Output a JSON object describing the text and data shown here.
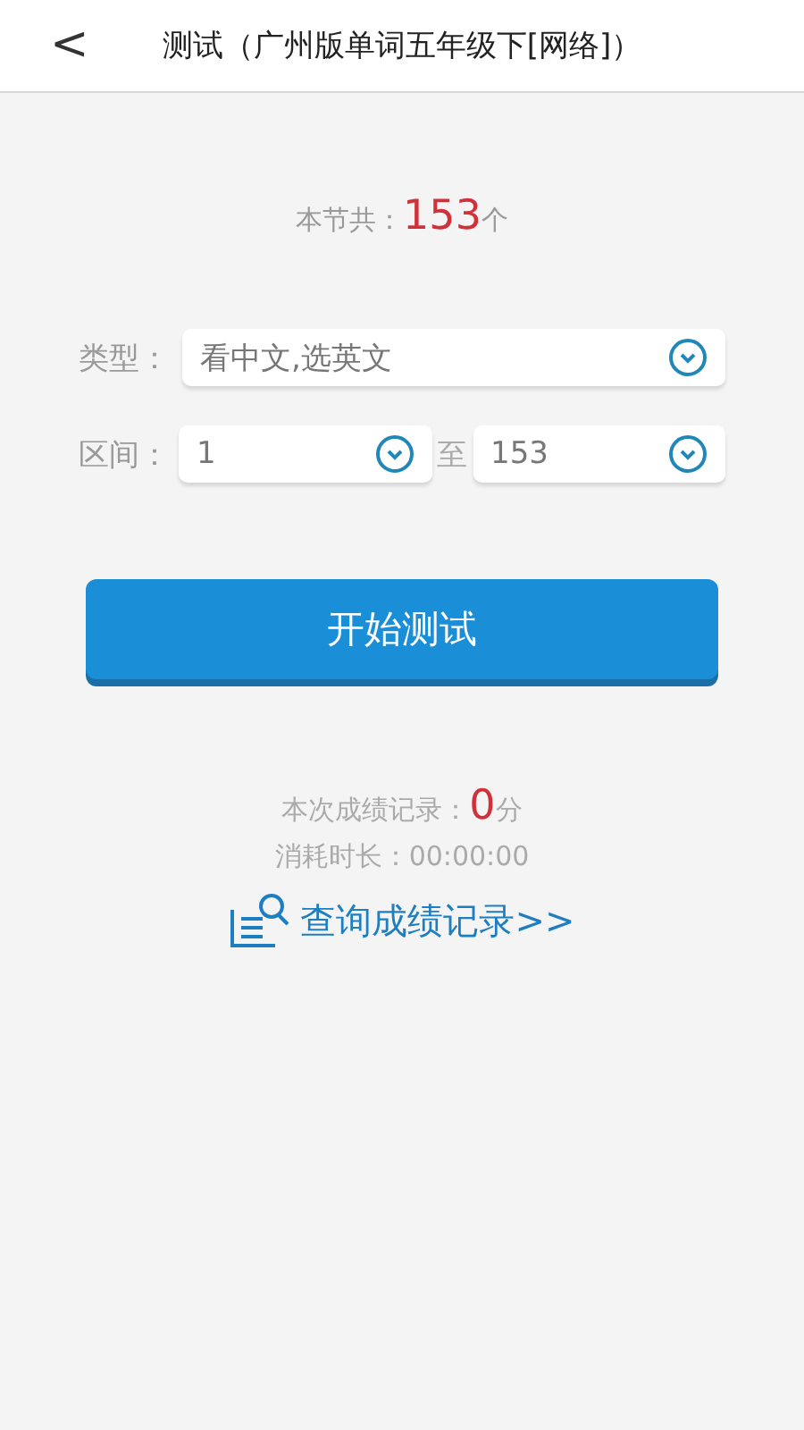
{
  "header": {
    "back_icon": "<",
    "title": "测试（广州版单词五年级下[网络]）"
  },
  "total": {
    "label": "本节共：",
    "count": "153",
    "unit": "个"
  },
  "type_row": {
    "label": "类型：",
    "value": "看中文,选英文"
  },
  "range_row": {
    "label": "区间：",
    "from": "1",
    "separator": "至",
    "to": "153"
  },
  "start_button": "开始测试",
  "score": {
    "label": "本次成绩记录：",
    "value": "0",
    "unit": "分"
  },
  "time": {
    "label": "消耗时长：",
    "value": "00:00:00"
  },
  "records_link": "查询成绩记录>>"
}
